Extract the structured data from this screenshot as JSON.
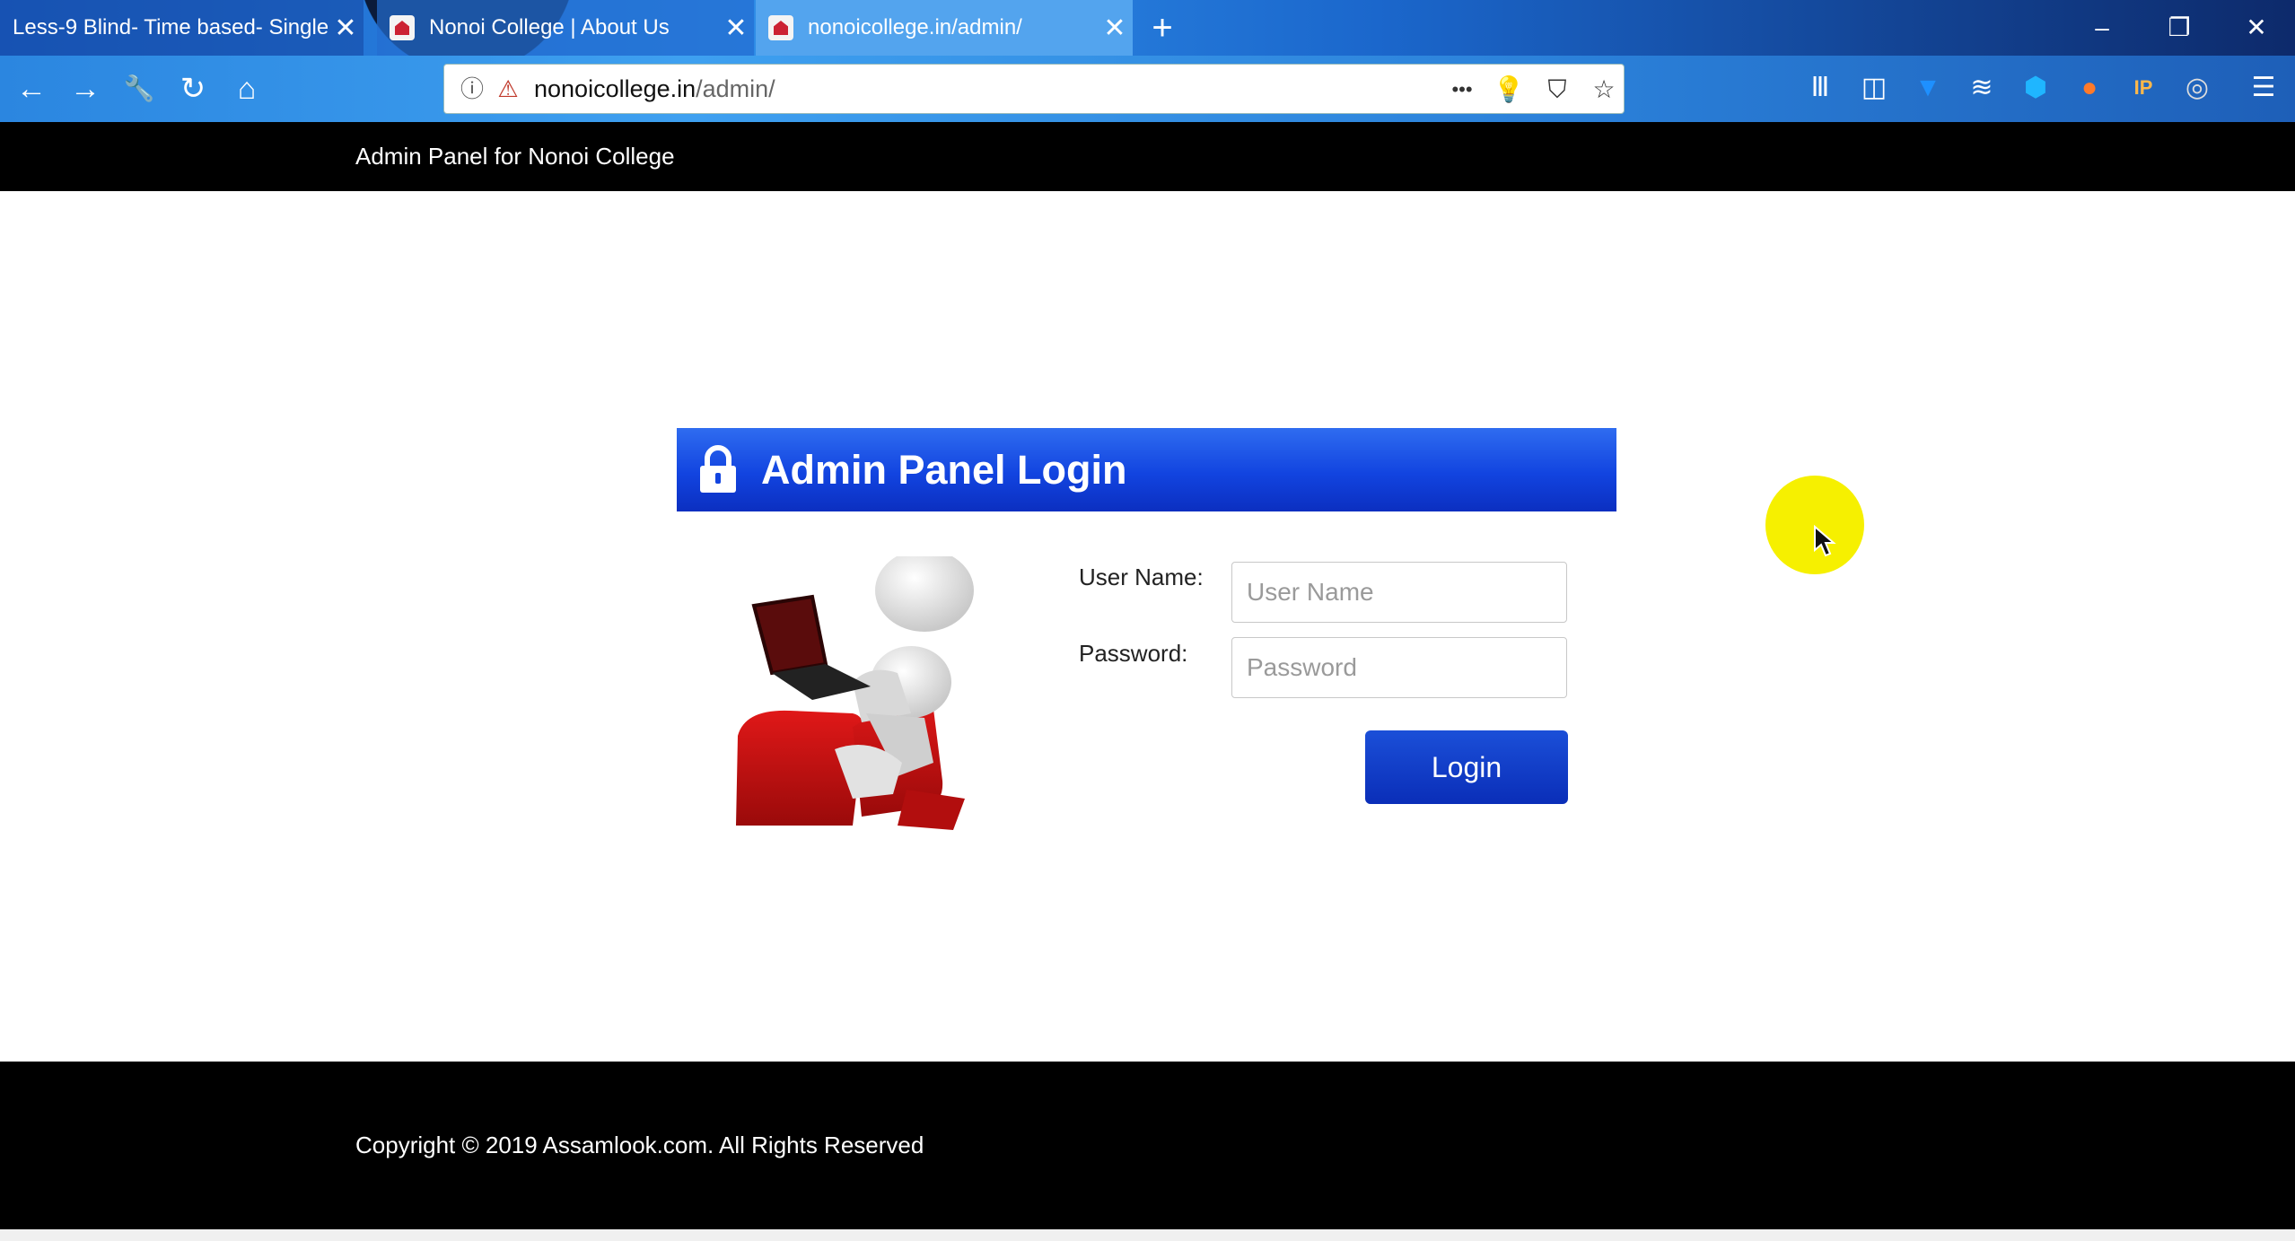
{
  "browser": {
    "tabs": [
      {
        "title": "Less-9 Blind- Time based- Single",
        "close": "✕"
      },
      {
        "title": "Nonoi College | About Us",
        "close": "✕"
      },
      {
        "title": "nonoicollege.in/admin/",
        "close": "✕"
      }
    ],
    "new_tab": "+",
    "window_controls": {
      "minimize": "–",
      "restore": "❐",
      "close": "✕"
    },
    "nav": {
      "back": "←",
      "forward": "→",
      "tools": "🔧",
      "reload": "↻",
      "home": "⌂"
    },
    "url": {
      "domain": "nonoicollege.in",
      "path": "/admin/",
      "info": "ⓘ",
      "insecure": "⚠"
    },
    "url_icons": {
      "more": "•••",
      "bulb": "💡",
      "pocket": "⛉",
      "bookmark": "☆"
    },
    "toolbar_icons": [
      "library-icon",
      "reader-icon",
      "pin-icon",
      "stack-icon",
      "hex-icon",
      "ball-icon",
      "ip-icon",
      "globe-icon",
      "menu-icon"
    ],
    "toolbar_glyphs": [
      "Ⅲ",
      "◫",
      "▼",
      "≋",
      "⬢",
      "●",
      "IP",
      "◎",
      "☰"
    ]
  },
  "site": {
    "header_title": "Admin Panel for Nonoi College",
    "panel_title": "Admin Panel Login",
    "form": {
      "username_label": "User Name:",
      "username_placeholder": "User Name",
      "password_label": "Password:",
      "password_placeholder": "Password",
      "login_label": "Login"
    },
    "footer": "Copyright © 2019 Assamlook.com. All Rights Reserved"
  },
  "colors": {
    "panel_blue": "#1244e0",
    "button_blue": "#0a2eb8",
    "cursor_highlight": "#f6f000",
    "header_black": "#000000"
  }
}
